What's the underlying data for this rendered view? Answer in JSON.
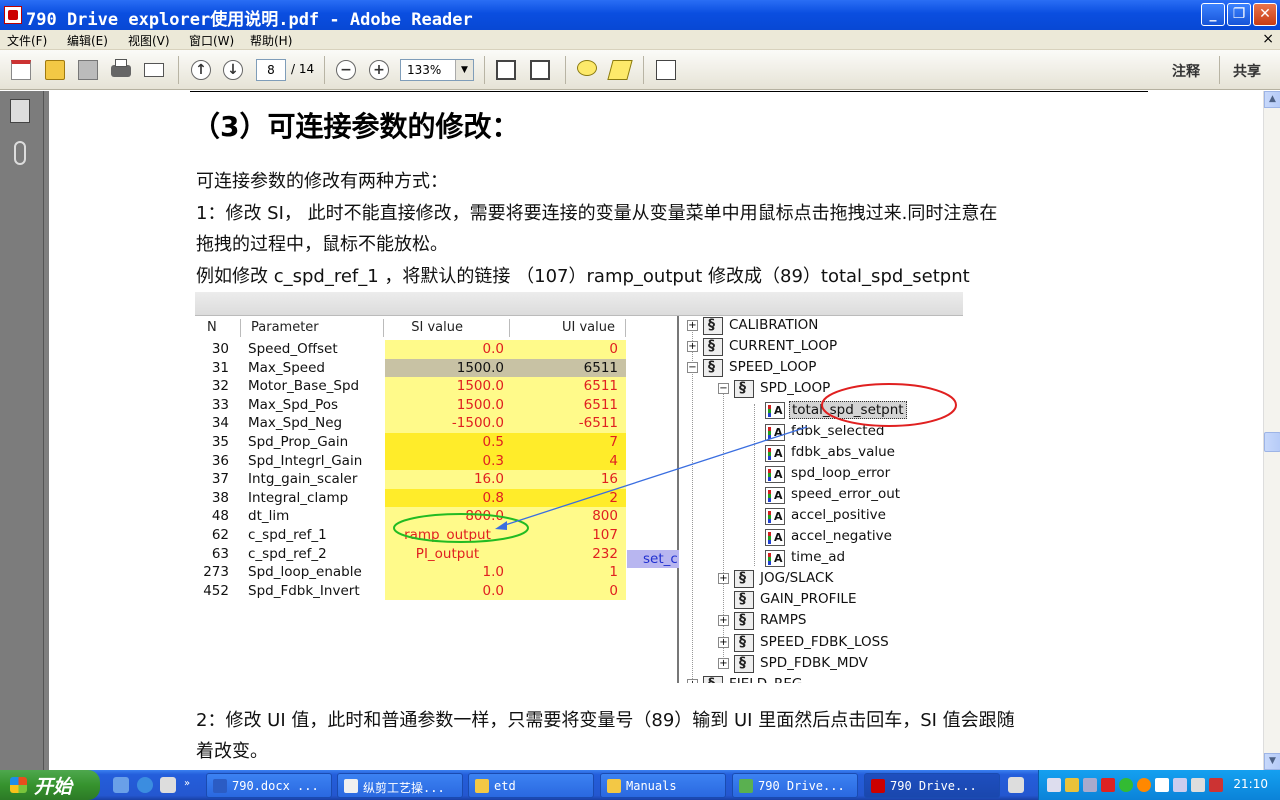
{
  "window": {
    "title": "790 Drive explorer使用说明.pdf - Adobe Reader"
  },
  "menu": [
    "文件(F)",
    "编辑(E)",
    "视图(V)",
    "窗口(W)",
    "帮助(H)"
  ],
  "toolbar": {
    "page_current": "8",
    "page_total": "/ 14",
    "zoom": "133%",
    "comment_label": "注释",
    "share_label": "共享"
  },
  "document": {
    "heading": "（3）可连接参数的修改：",
    "para1": "可连接参数的修改有两种方式：",
    "para2": "1：修改 SI，  此时不能直接修改，需要将要连接的变量从变量菜单中用鼠标点击拖拽过来.同时注意在",
    "para3": "拖拽的过程中，鼠标不能放松。",
    "para4": "例如修改  c_spd_ref_1   ，将默认的链接  （107）ramp_output  修改成（89）total_spd_setpnt",
    "para5": "2：修改 UI 值，此时和普通参数一样，只需要将变量号（89）输到 UI 里面然后点击回车，SI 值会跟随",
    "para6": "着改变。"
  },
  "figure": {
    "headers": {
      "n": "N",
      "param": "Parameter",
      "si": "SI value",
      "ui": "UI value"
    },
    "rows": [
      {
        "n": "30",
        "param": "Speed_Offset",
        "si": "0.0",
        "ui": "0"
      },
      {
        "n": "31",
        "param": "Max_Speed",
        "si": "1500.0",
        "ui": "6511"
      },
      {
        "n": "32",
        "param": "Motor_Base_Spd",
        "si": "1500.0",
        "ui": "6511"
      },
      {
        "n": "33",
        "param": "Max_Spd_Pos",
        "si": "1500.0",
        "ui": "6511"
      },
      {
        "n": "34",
        "param": "Max_Spd_Neg",
        "si": "-1500.0",
        "ui": "-6511"
      },
      {
        "n": "35",
        "param": "Spd_Prop_Gain",
        "si": "0.5",
        "ui": "7"
      },
      {
        "n": "36",
        "param": "Spd_Integrl_Gain",
        "si": "0.3",
        "ui": "4"
      },
      {
        "n": "37",
        "param": "Intg_gain_scaler",
        "si": "16.0",
        "ui": "16"
      },
      {
        "n": "38",
        "param": "Integral_clamp",
        "si": "0.8",
        "ui": "2"
      },
      {
        "n": "48",
        "param": "dt_lim",
        "si": "800.0",
        "ui": "800"
      },
      {
        "n": "62",
        "param": "c_spd_ref_1",
        "si": "ramp_output",
        "ui": "107"
      },
      {
        "n": "63",
        "param": "c_spd_ref_2",
        "si": "PI_output",
        "ui": "232"
      },
      {
        "n": "273",
        "param": "Spd_loop_enable",
        "si": "1.0",
        "ui": "1"
      },
      {
        "n": "452",
        "param": "Spd_Fdbk_Invert",
        "si": "0.0",
        "ui": "0"
      }
    ],
    "set_link": "set_c",
    "tree": [
      {
        "label": "CALIBRATION",
        "level": 0,
        "pm": "+",
        "icon": "block"
      },
      {
        "label": "CURRENT_LOOP",
        "level": 0,
        "pm": "+",
        "icon": "block"
      },
      {
        "label": "SPEED_LOOP",
        "level": 0,
        "pm": "−",
        "icon": "block"
      },
      {
        "label": "SPD_LOOP",
        "level": 1,
        "pm": "−",
        "icon": "block"
      },
      {
        "label": "total_spd_setpnt",
        "level": 2,
        "pm": "",
        "icon": "analog",
        "selected": true
      },
      {
        "label": "fdbk_selected",
        "level": 2,
        "pm": "",
        "icon": "analog"
      },
      {
        "label": "fdbk_abs_value",
        "level": 2,
        "pm": "",
        "icon": "analog"
      },
      {
        "label": "spd_loop_error",
        "level": 2,
        "pm": "",
        "icon": "analog"
      },
      {
        "label": "speed_error_out",
        "level": 2,
        "pm": "",
        "icon": "analog"
      },
      {
        "label": "accel_positive",
        "level": 2,
        "pm": "",
        "icon": "analog"
      },
      {
        "label": "accel_negative",
        "level": 2,
        "pm": "",
        "icon": "analog"
      },
      {
        "label": "time_ad",
        "level": 2,
        "pm": "",
        "icon": "analog"
      },
      {
        "label": "JOG/SLACK",
        "level": 1,
        "pm": "+",
        "icon": "block"
      },
      {
        "label": "GAIN_PROFILE",
        "level": 1,
        "pm": "",
        "icon": "block"
      },
      {
        "label": "RAMPS",
        "level": 1,
        "pm": "+",
        "icon": "block"
      },
      {
        "label": "SPEED_FDBK_LOSS",
        "level": 1,
        "pm": "+",
        "icon": "block"
      },
      {
        "label": "SPD_FDBK_MDV",
        "level": 1,
        "pm": "+",
        "icon": "block"
      },
      {
        "label": "FIELD_REG",
        "level": 0,
        "pm": "+",
        "icon": "block"
      }
    ]
  },
  "taskbar": {
    "start_label": "开始",
    "tasks": [
      "790.docx ...",
      "纵剪工艺操...",
      "etd",
      "Manuals",
      "790 Drive...",
      "790 Drive..."
    ],
    "clock": "21:10"
  }
}
